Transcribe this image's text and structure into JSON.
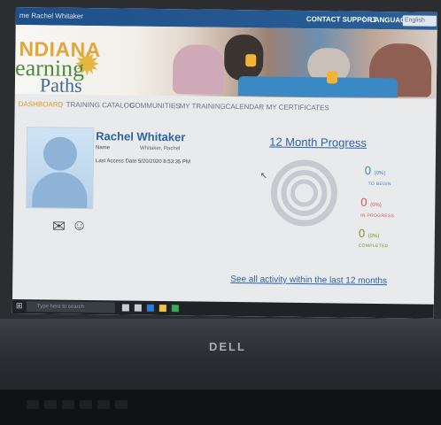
{
  "header": {
    "welcome": "me Rachel Whitaker",
    "contact_support": "CONTACT SUPPORT",
    "separator": "|",
    "language_label": "LANGUAGE",
    "language_value": "English (US)"
  },
  "logo": {
    "line1": "NDIANA",
    "line2": "earning",
    "line3": "Paths"
  },
  "nav": {
    "items": [
      "DASHBOARD",
      "TRAINING CATALOG",
      "COMMUNITIES",
      "MY TRAINING",
      "CALENDAR",
      "MY CERTIFICATES"
    ],
    "active": "DASHBOARD"
  },
  "profile": {
    "name": "Rachel Whitaker",
    "name_label": "Name",
    "name_value": "Whitaker, Rachel",
    "last_access": "Last Access Date 5/20/2020 8:53:35 PM"
  },
  "progress": {
    "title": "12 Month Progress",
    "to_begin": {
      "count": "0",
      "pct": "(0%)",
      "label": "TO BEGIN",
      "color": "#3f7fc4"
    },
    "in_progress": {
      "count": "0",
      "pct": "(0%)",
      "label": "IN PROGRESS",
      "color": "#d9534f"
    },
    "completed": {
      "count": "0",
      "pct": "(0%)",
      "label": "COMPLETED",
      "color": "#8a8f2a"
    },
    "see_all": "See all activity within the last 12 months"
  },
  "taskbar": {
    "search_placeholder": "Type here to search"
  },
  "laptop": {
    "brand": "DELL"
  },
  "colors": {
    "accent": "#2b63a5",
    "nav_active": "#e39a2d",
    "topbar": "#1e4f88"
  }
}
